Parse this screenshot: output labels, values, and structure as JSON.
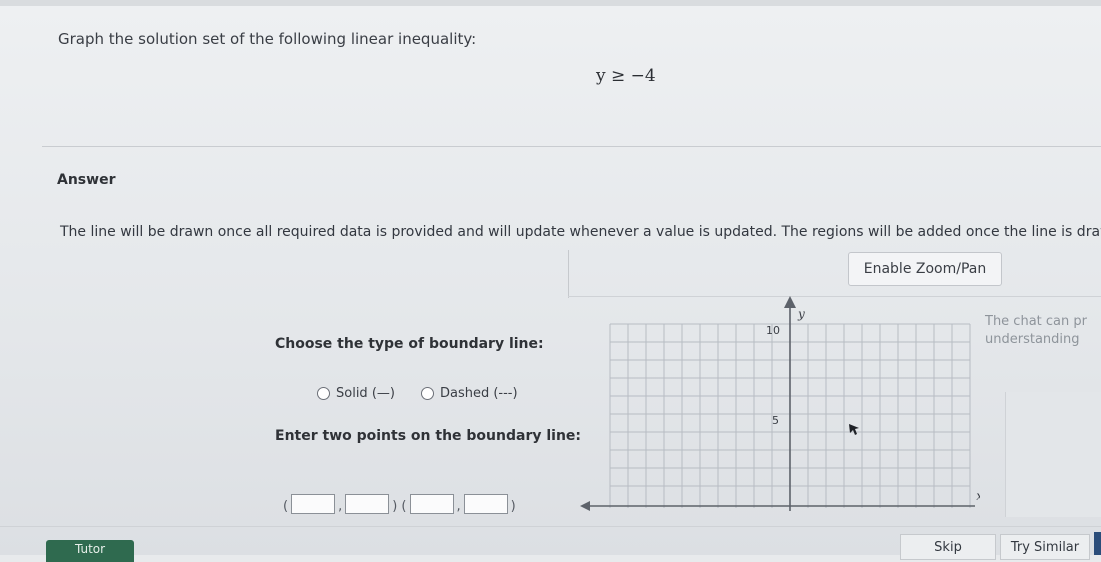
{
  "question": {
    "prompt": "Graph the solution set of the following linear inequality:",
    "inequality": "y ≥ −4"
  },
  "answer": {
    "label": "Answer",
    "notice": "The line will be drawn once all required data is provided and will update whenever a value is updated. The regions will be added once the line is drawn."
  },
  "toolbar": {
    "zoom_label": "Enable Zoom/Pan"
  },
  "boundary": {
    "label": "Choose the type of boundary line:",
    "options": [
      {
        "label": "Solid (—)",
        "selected": false
      },
      {
        "label": "Dashed (---)",
        "selected": false
      }
    ]
  },
  "points": {
    "label": "Enter two points on the boundary line:",
    "open_paren": "(",
    "comma": ",",
    "separator": ") (",
    "close_paren": ")"
  },
  "graph": {
    "y_axis_label": "y",
    "x_axis_label": "x",
    "tick_labels": [
      "10",
      "5"
    ]
  },
  "chat": {
    "line1": "The chat can pr",
    "line2": "understanding"
  },
  "footer": {
    "tutor_label": "Tutor",
    "skip_label": "Skip",
    "similar_label": "Try Similar"
  },
  "colors": {
    "tutor_bg": "#2f6a4f",
    "edge_tab": "#2b4d7a"
  }
}
